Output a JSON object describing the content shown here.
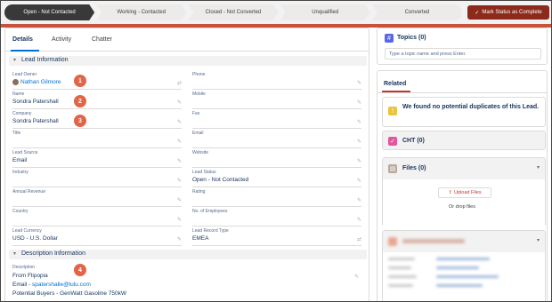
{
  "path": {
    "stages": [
      "Open - Not Contacted",
      "Working - Contacted",
      "Closed - Not Converted",
      "Unqualified",
      "Converted"
    ],
    "mark_complete": "Mark Status as Complete"
  },
  "tabs": [
    "Details",
    "Activity",
    "Chatter"
  ],
  "sections": {
    "lead_info": "Lead Information",
    "description_info": "Description Information"
  },
  "fields": {
    "lead_owner": {
      "label": "Lead Owner",
      "value": "Nathan Gilmore"
    },
    "phone": {
      "label": "Phone",
      "value": ""
    },
    "name": {
      "label": "Name",
      "value": "Sondra Patershall"
    },
    "mobile": {
      "label": "Mobile",
      "value": ""
    },
    "company": {
      "label": "Company",
      "value": "Sondra Patershall"
    },
    "fax": {
      "label": "Fax",
      "value": ""
    },
    "title": {
      "label": "Title",
      "value": ""
    },
    "email": {
      "label": "Email",
      "value": ""
    },
    "lead_source": {
      "label": "Lead Source",
      "value": "Email"
    },
    "website": {
      "label": "Website",
      "value": ""
    },
    "industry": {
      "label": "Industry",
      "value": ""
    },
    "lead_status": {
      "label": "Lead Status",
      "value": "Open - Not Contacted"
    },
    "annual_revenue": {
      "label": "Annual Revenue",
      "value": ""
    },
    "rating": {
      "label": "Rating",
      "value": ""
    },
    "country": {
      "label": "Country",
      "value": ""
    },
    "employees": {
      "label": "No. of Employees",
      "value": ""
    },
    "lead_currency": {
      "label": "Lead Currency",
      "value": "USD - U.S. Dollar"
    },
    "record_type": {
      "label": "Lead Record Type",
      "value": "EMEA"
    }
  },
  "description": {
    "label": "Description",
    "line1": "From Flipopia",
    "line2_prefix": "Email - ",
    "line2_email": "spatershalle@lulu.com",
    "line3": "Potential Buyers - GenWatt Gasoline 750kW"
  },
  "callouts": [
    "1",
    "2",
    "3",
    "4"
  ],
  "right": {
    "topics_title": "Topics (0)",
    "topics_placeholder": "Type a topic name and press Enter.",
    "related_tab": "Related",
    "duplicates": "We found no potential duplicates of this Lead.",
    "cht": "CHT (0)",
    "files": "Files (0)",
    "upload": "Upload Files",
    "drop": "Or drop files"
  },
  "colors": {
    "accent": "#0070d2",
    "callout": "#e26548",
    "mark_button": "#8c2a1b",
    "current_stage": "#39393a"
  }
}
